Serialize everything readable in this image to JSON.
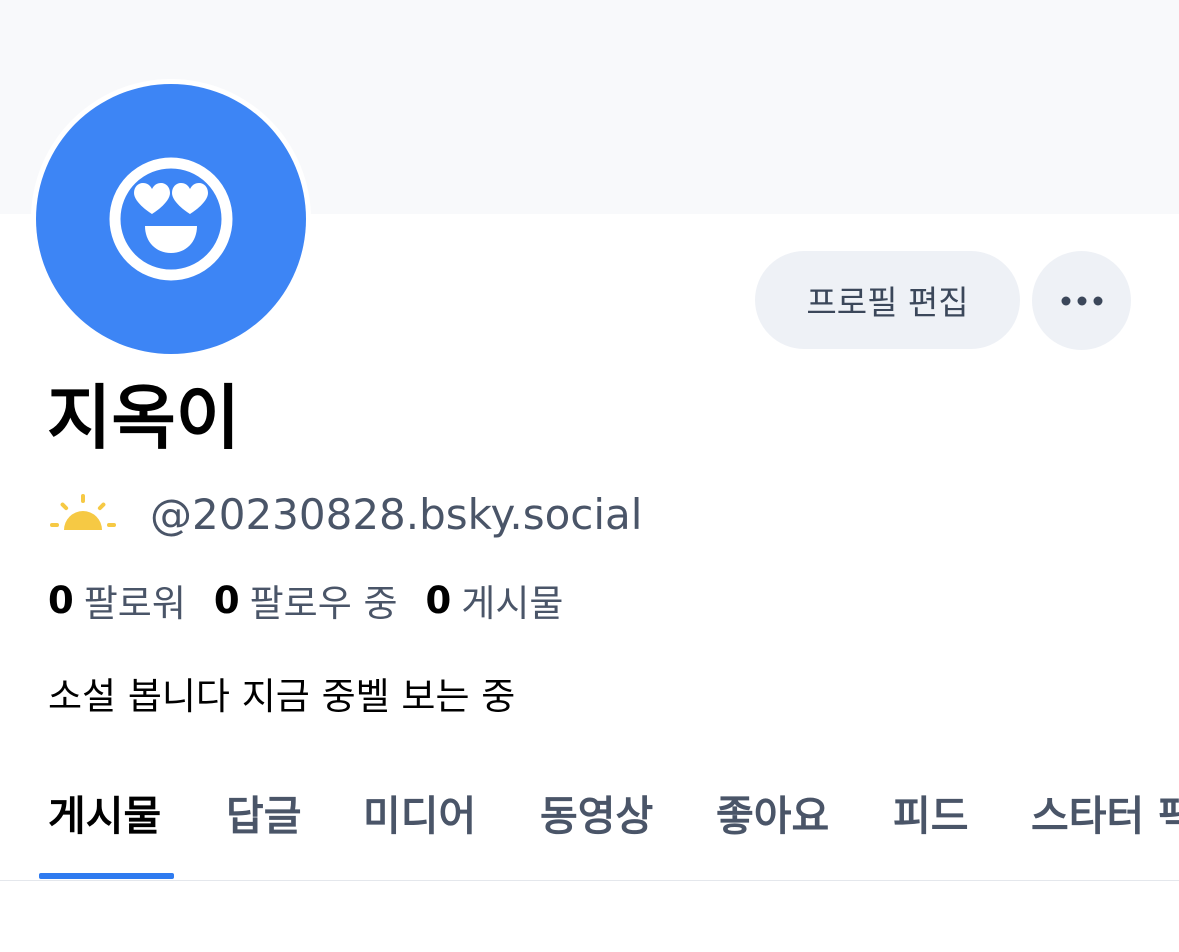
{
  "profile": {
    "display_name": "지옥이",
    "handle": "@20230828.bsky.social",
    "bio": "소설 봅니다 지금 중벨 보는 중",
    "avatar_icon": "heart-eyes-smile-icon",
    "handle_badge_icon": "sunrise-icon"
  },
  "actions": {
    "edit_label": "프로필 편집",
    "more_icon": "ellipsis-icon"
  },
  "stats": [
    {
      "count": "0",
      "label": "팔로워"
    },
    {
      "count": "0",
      "label": "팔로우 중"
    },
    {
      "count": "0",
      "label": "게시물"
    }
  ],
  "tabs": [
    {
      "label": "게시물",
      "active": true
    },
    {
      "label": "답글"
    },
    {
      "label": "미디어"
    },
    {
      "label": "동영상"
    },
    {
      "label": "좋아요"
    },
    {
      "label": "피드"
    },
    {
      "label": "스타터 팩"
    }
  ],
  "colors": {
    "accent": "#2f7bf0",
    "avatar_bg": "#3d85f5",
    "button_bg": "#eef1f6",
    "banner_bg": "#f8f9fb",
    "muted_text": "#4a5568",
    "sun_yellow": "#f6c944"
  }
}
